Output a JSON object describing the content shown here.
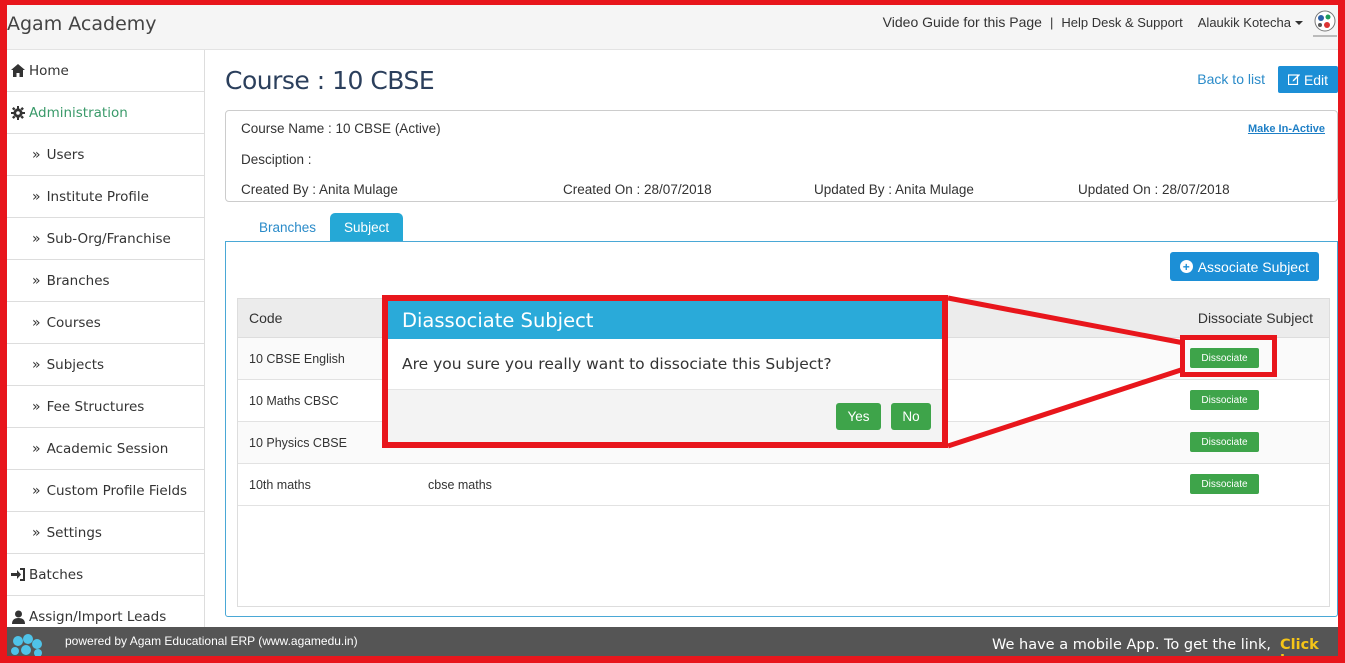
{
  "header": {
    "brand": "Agam Academy",
    "video_guide": "Video Guide for this Page",
    "separator": "|",
    "help_desk": "Help Desk & Support",
    "user_name": "Alaukik Kotecha"
  },
  "sidebar": {
    "items": [
      {
        "label": "Home",
        "icon": "home-icon",
        "level": "top"
      },
      {
        "label": "Administration",
        "icon": "gear-icon",
        "level": "top",
        "active": true
      },
      {
        "label": "Users",
        "icon": "chevron-double-right-icon",
        "level": "sub"
      },
      {
        "label": "Institute Profile",
        "icon": "chevron-double-right-icon",
        "level": "sub"
      },
      {
        "label": "Sub-Org/Franchise",
        "icon": "chevron-double-right-icon",
        "level": "sub"
      },
      {
        "label": "Branches",
        "icon": "chevron-double-right-icon",
        "level": "sub"
      },
      {
        "label": "Courses",
        "icon": "chevron-double-right-icon",
        "level": "sub"
      },
      {
        "label": "Subjects",
        "icon": "chevron-double-right-icon",
        "level": "sub"
      },
      {
        "label": "Fee Structures",
        "icon": "chevron-double-right-icon",
        "level": "sub"
      },
      {
        "label": "Academic Session",
        "icon": "chevron-double-right-icon",
        "level": "sub"
      },
      {
        "label": "Custom Profile Fields",
        "icon": "chevron-double-right-icon",
        "level": "sub"
      },
      {
        "label": "Settings",
        "icon": "chevron-double-right-icon",
        "level": "sub"
      },
      {
        "label": "Batches",
        "icon": "sign-in-icon",
        "level": "top"
      },
      {
        "label": "Assign/Import Leads",
        "icon": "user-icon",
        "level": "top"
      }
    ]
  },
  "main": {
    "title": "Course : 10 CBSE",
    "back_to_list": "Back to list",
    "edit": "Edit",
    "info": {
      "course_name": "Course Name : 10 CBSE (Active)",
      "description": "Desciption :",
      "make_inactive": "Make In-Active",
      "created_by": "Created By : Anita Mulage",
      "created_on": "Created On : 28/07/2018",
      "updated_by": "Updated By : Anita Mulage",
      "updated_on": "Updated On : 28/07/2018"
    },
    "tabs": [
      {
        "label": "Branches",
        "active": false
      },
      {
        "label": "Subject",
        "active": true
      }
    ],
    "associate_subject": "Associate Subject",
    "table": {
      "columns": [
        "Code",
        "Dissociate Subject"
      ],
      "rows": [
        {
          "code": "10 CBSE English",
          "description": "",
          "action": "Dissociate"
        },
        {
          "code": "10 Maths CBSC",
          "description": "",
          "action": "Dissociate"
        },
        {
          "code": "10 Physics CBSE",
          "description": "",
          "action": "Dissociate"
        },
        {
          "code": "10th maths",
          "description": "cbse maths",
          "action": "Dissociate"
        }
      ]
    }
  },
  "modal": {
    "title": "Diassociate Subject",
    "message": "Are you sure you really want to dissociate this Subject?",
    "yes": "Yes",
    "no": "No"
  },
  "footer": {
    "powered_by": "powered by Agam Educational ERP (www.agamedu.in)",
    "mobile_app": "We have a mobile App. To get the link,",
    "click_here": "Click here"
  },
  "colors": {
    "annotation_red": "#e8161c",
    "primary_blue": "#1c8fd6",
    "modal_header": "#2aaad9",
    "success_green": "#3ea44a",
    "active_sidebar": "#3a9a6a"
  }
}
